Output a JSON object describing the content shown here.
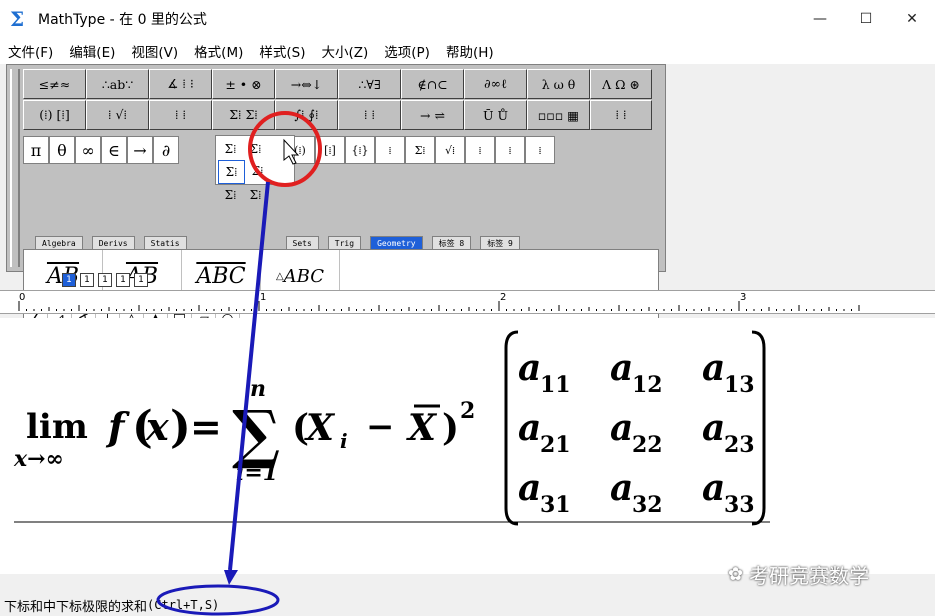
{
  "window": {
    "title": "MathType - 在 0 里的公式",
    "minimize": "—",
    "maximize": "☐",
    "close": "✕",
    "app_icon": "Σ"
  },
  "menu": [
    "文件(F)",
    "编辑(E)",
    "视图(V)",
    "格式(M)",
    "样式(S)",
    "大小(Z)",
    "选项(P)",
    "帮助(H)"
  ],
  "toolbar": {
    "row1": [
      "≤≠≈",
      "∴ab∵",
      "∡ ⁞ ⁝",
      "± • ⊗",
      "→⇔↓",
      "∴∀∃",
      "∉∩⊂",
      "∂∞ℓ",
      "λ ω θ",
      "Λ Ω ⊛"
    ],
    "row2": [
      "(⁞) [⁞]",
      "⁞ √⁞",
      "⁞ ⁞",
      "Σ⁞ Σ⁞",
      "∫⁞ ∮⁞",
      "⁞ ⁞",
      "→ ⇌",
      "Ū Ů",
      "▫▫▫ ▦",
      "⁞ ⁞"
    ],
    "symbols": [
      "π",
      "θ",
      "∞",
      "∈",
      "→",
      "∂"
    ],
    "row3_rest": [
      "(⁞)",
      "[⁞]",
      "{⁞}",
      "⁞",
      "Σ⁞",
      "√⁞",
      "⁞",
      "⁞",
      "⁞"
    ],
    "popup": [
      "Σ⁞",
      "Σ⁞",
      "Σ⁞",
      "Σ⁞",
      "Σ⁞",
      "Σ⁞"
    ],
    "tabs": [
      "Algebra",
      "Derivs",
      "Statis",
      "Sets",
      "Trig",
      "Geometry",
      "标签 8",
      "标签 9"
    ],
    "active_tab": "Geometry",
    "templates": [
      "AB",
      "AB",
      "ABC",
      "ABC"
    ],
    "shapes": [
      "∠",
      "⊿",
      "∢",
      "⊥",
      "△",
      "▲",
      "□",
      "▱",
      "○"
    ],
    "small_buttons": [
      "1",
      "1",
      "1",
      "1",
      "1"
    ]
  },
  "ruler": [
    "0",
    "1",
    "2",
    "3"
  ],
  "formula": {
    "lim": "lim",
    "lim_sub": "x→∞",
    "f": "f",
    "x": "x",
    "eq": "=",
    "sigma": "∑",
    "sum_upper": "n",
    "sum_lower": "i=1",
    "X": "X",
    "i": "i",
    "minus": "−",
    "Xbar": "X",
    "sq": "2",
    "matrix": [
      [
        "a",
        "11",
        "a",
        "12",
        "a",
        "13"
      ],
      [
        "a",
        "21",
        "a",
        "22",
        "a",
        "23"
      ],
      [
        "a",
        "31",
        "a",
        "32",
        "a",
        "33"
      ]
    ]
  },
  "status": {
    "text": "下标和中下标极限的求和",
    "shortcut": "(Ctrl+T,S)"
  },
  "watermark": "考研竞赛数学",
  "colors": {
    "accent": "#1e5fd8",
    "annotation_red": "#e02020",
    "annotation_blue": "#1a1ab8"
  }
}
